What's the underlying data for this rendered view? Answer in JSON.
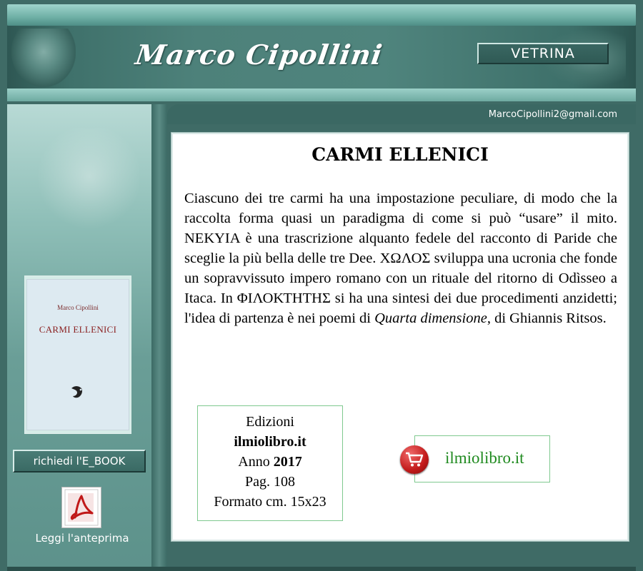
{
  "header": {
    "author_logo": "Marco Cipollini",
    "nav_button": "VETRINA",
    "email": "MarcoCipollini2@gmail.com"
  },
  "book": {
    "title": "CARMI ELLENICI",
    "desc_1": "Ciascuno dei tre carmi ha una impostazione peculiare, di modo che la raccolta forma quasi un paradigma di come si può “usare” il mito. NEKYIA è una trascrizione alquanto fedele del racconto di Paride che sceglie la più bella delle tre Dee. ΧΩΛΟΣ sviluppa una ucronia che fonde un sopravvissuto impero romano con un rituale del ritorno di Odìsseo a Itaca. In ΦΙΛΟΚΤΗΤΗΣ si ha una sintesi dei due procedimenti anzidetti; l'idea di partenza è nei poemi di ",
    "desc_italic": "Quarta dimensione",
    "desc_2": ", di Ghiannis Ritsos."
  },
  "publisher": {
    "edition_label": "Edizioni",
    "name": "ilmiolibro.it",
    "year_label": "Anno",
    "year": "2017",
    "pages": "Pag. 108",
    "format": "Formato cm. 15x23"
  },
  "shop": {
    "label": "ilmiolibro.it",
    "icon": "shopping-cart-icon"
  },
  "cover": {
    "author": "Marco Cipollini",
    "title": "CARMI ELLENICI"
  },
  "sidebar": {
    "ebook_button": "richiedi l'E_BOOK",
    "preview_label": "Leggi l'anteprima",
    "preview_icon": "pdf-icon"
  },
  "colors": {
    "theme": "#3f6b66",
    "shop_text": "#1f8a1f",
    "cart_red": "#c21a1a"
  }
}
